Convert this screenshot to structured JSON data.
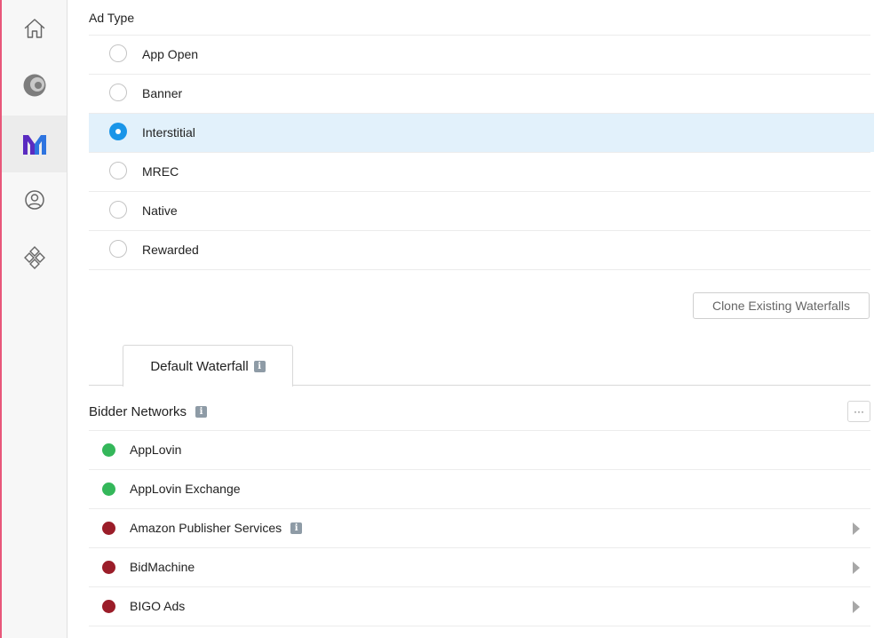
{
  "sidebar": {
    "items": [
      {
        "name": "home",
        "icon": "home-icon"
      },
      {
        "name": "analytics",
        "icon": "c-logo-icon"
      },
      {
        "name": "mediation",
        "icon": "m-logo-icon",
        "active": true
      },
      {
        "name": "account",
        "icon": "user-icon"
      },
      {
        "name": "integrations",
        "icon": "diamond-grid-icon"
      }
    ]
  },
  "ad_type": {
    "label": "Ad Type",
    "options": [
      {
        "label": "App Open",
        "selected": false
      },
      {
        "label": "Banner",
        "selected": false
      },
      {
        "label": "Interstitial",
        "selected": true
      },
      {
        "label": "MREC",
        "selected": false
      },
      {
        "label": "Native",
        "selected": false
      },
      {
        "label": "Rewarded",
        "selected": false
      }
    ]
  },
  "clone_button": "Clone Existing Waterfalls",
  "tabs": [
    {
      "label": "Default Waterfall",
      "info": "i"
    }
  ],
  "bidder": {
    "title": "Bidder Networks",
    "info": "i",
    "more": "···",
    "networks": [
      {
        "label": "AppLovin",
        "status_color": "#34b75a"
      },
      {
        "label": "AppLovin Exchange",
        "status_color": "#34b75a"
      },
      {
        "label": "Amazon Publisher Services",
        "status_color": "#9b1d29",
        "info": "i"
      },
      {
        "label": "BidMachine",
        "status_color": "#9b1d29"
      },
      {
        "label": "BIGO Ads",
        "status_color": "#9b1d29"
      }
    ]
  },
  "colors": {
    "accent": "#1a95e8",
    "selected_row": "#e2f1fb",
    "active": "#34b75a",
    "inactive": "#9b1d29"
  }
}
